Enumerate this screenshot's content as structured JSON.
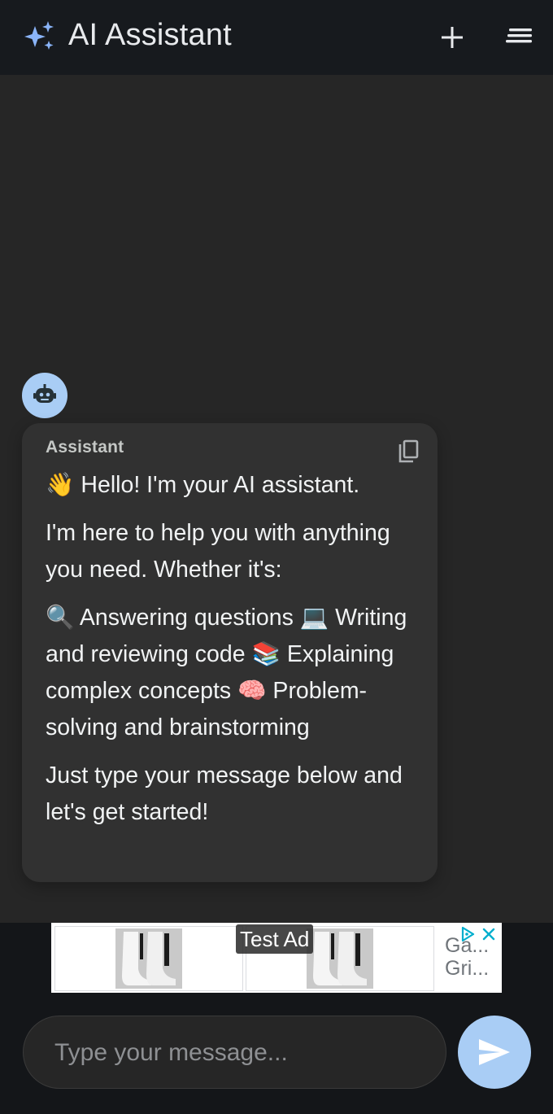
{
  "header": {
    "title": "AI Assistant",
    "sparkle_icon": "sparkle-icon",
    "new_chat_icon": "plus-icon",
    "menu_icon": "menu-icon"
  },
  "message": {
    "sender": "Assistant",
    "avatar_icon": "robot-icon",
    "copy_icon": "copy-icon",
    "paragraphs": [
      "👋 Hello! I'm your AI assistant.",
      "I'm here to help you with anything you need. Whether it's:",
      "🔍 Answering questions 💻 Writing and reviewing code 📚 Explaining complex concepts 🧠 Problem-solving and brainstorming",
      "Just type your message below and let's get started!"
    ]
  },
  "ad": {
    "label": "Test Ad",
    "title": "Ga...\nGri...",
    "choices_icon": "adchoices-icon",
    "close_icon": "close-icon"
  },
  "composer": {
    "placeholder": "Type your message...",
    "value": "",
    "send_icon": "send-icon"
  },
  "colors": {
    "header_bg": "#171a1e",
    "chat_bg": "#262626",
    "bubble_bg": "#313131",
    "accent": "#a9cdf5",
    "sparkle": "#8ab4f8"
  }
}
